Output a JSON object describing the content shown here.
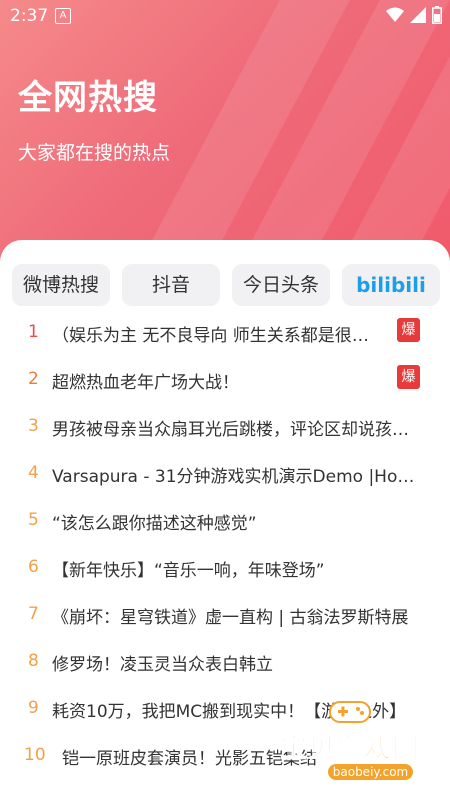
{
  "status_bar": {
    "time": "2:37",
    "badge": "A"
  },
  "header": {
    "title": "全网热搜",
    "subtitle": "大家都在搜的热点"
  },
  "tabs": [
    {
      "label": "微博热搜"
    },
    {
      "label": "抖音"
    },
    {
      "label": "今日头条"
    },
    {
      "label": "bilibili"
    }
  ],
  "list": [
    {
      "rank": "1",
      "text": "（娱乐为主 无不良导向 师生关系都是很友…",
      "badge": "爆"
    },
    {
      "rank": "2",
      "text": "超燃热血老年广场大战！",
      "badge": "爆"
    },
    {
      "rank": "3",
      "text": "男孩被母亲当众扇耳光后跳楼，评论区却说孩子…"
    },
    {
      "rank": "4",
      "text": "Varsapura - 31分钟游戏实机演示Demo |HoYove…"
    },
    {
      "rank": "5",
      "text": "“该怎么跟你描述这种感觉”"
    },
    {
      "rank": "6",
      "text": "【新年快乐】“音乐一响，年味登场”"
    },
    {
      "rank": "7",
      "text": "《崩坏：星穹铁道》虚一直构 | 古翁法罗斯特展"
    },
    {
      "rank": "8",
      "text": "修罗场！凌玉灵当众表白韩立"
    },
    {
      "rank": "9",
      "text": "耗资10万，我把MC搬到现实中！【游戏之外】"
    },
    {
      "rank": "10",
      "text": "铠一原班皮套演员！光影五铠集结"
    }
  ],
  "watermark": {
    "text": "宝贝游戏网",
    "url": "baobeiy.com"
  }
}
